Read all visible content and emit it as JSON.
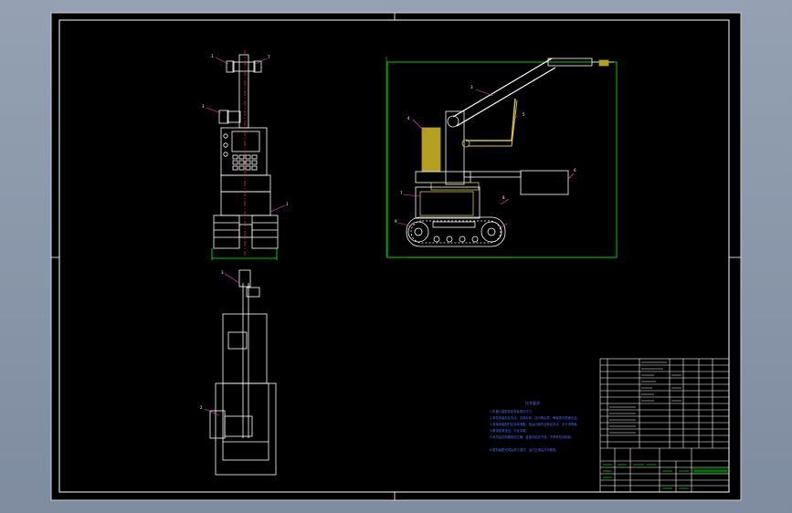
{
  "drawing": {
    "title": "",
    "background_color": "#000000",
    "frame_color": "#ffffff",
    "part_label_color": "#ff3bd6",
    "notes_color": "#4a6bff",
    "titleblock_accent": "#00ff00"
  },
  "views": {
    "front_labels": [
      "1",
      "7",
      "3",
      "1"
    ],
    "side_labels": [
      "3",
      "4",
      "5",
      "6",
      "7",
      "8",
      "9"
    ],
    "top_labels": [
      "3",
      "2"
    ]
  },
  "tech_notes": {
    "heading": "技术要求",
    "lines": [
      "1.机器人装配前检查各零件尺寸。",
      "2.零件安装前应清洁，去除毛刺、油污等杂质，确保零件表面光洁。",
      "3.各轴承装配时应涂润滑脂，各运动部件应转动灵活，无卡滞现象。",
      "4.履带张紧适当，行走平稳。",
      "5.电机及控制器接线正确，各部件固定可靠，不得有松动现象。",
      "6.整机装配完成后进行调试，运行正常后方可使用。"
    ]
  },
  "title_block": {
    "drawing_name": "",
    "cells": []
  }
}
